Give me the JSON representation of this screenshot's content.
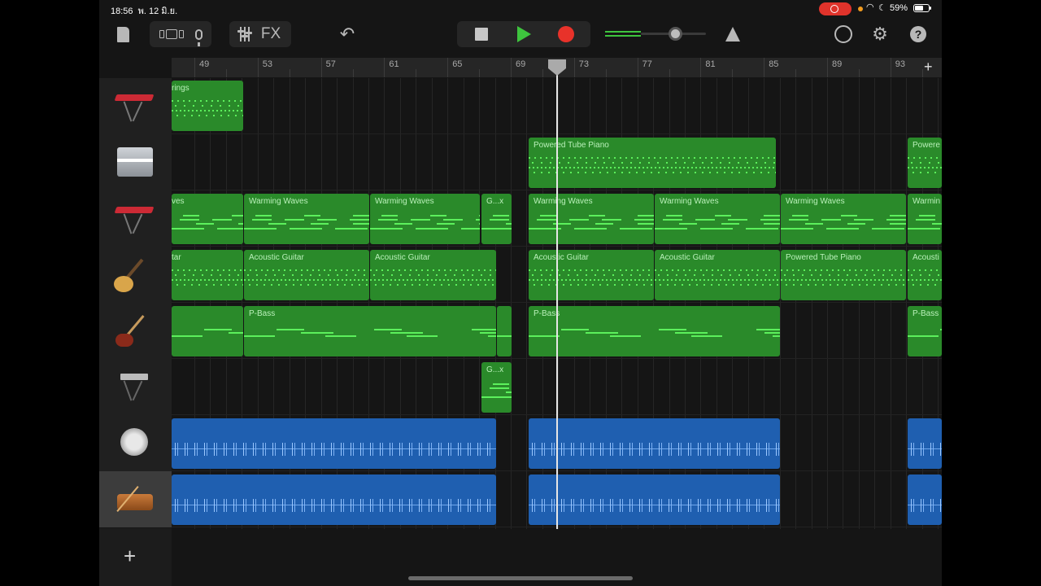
{
  "status_bar": {
    "time": "18:56",
    "date": "พ. 12 มิ.ย.",
    "battery": "59%"
  },
  "toolbar": {
    "fx_label": "FX",
    "accent_play": "#3ec43e",
    "accent_record": "#e8322a",
    "volume_level": 0.65
  },
  "ruler": {
    "bars": [
      "49",
      "53",
      "57",
      "61",
      "65",
      "69",
      "73",
      "77",
      "81",
      "85",
      "89",
      "93"
    ],
    "add_label": "+"
  },
  "tracks": [
    {
      "instrument": "keyboard-red-icon",
      "regions": [
        {
          "label": "rings",
          "color": "#2a8a2a"
        }
      ]
    },
    {
      "instrument": "piano-icon",
      "regions": [
        {
          "label": "Powered Tube Piano"
        },
        {
          "label": "Powere"
        }
      ]
    },
    {
      "instrument": "keyboard-red-icon",
      "regions": [
        {
          "label": "ves"
        },
        {
          "label": "Warming Waves"
        },
        {
          "label": "Warming Waves"
        },
        {
          "label": "G...x"
        },
        {
          "label": "Warming Waves"
        },
        {
          "label": "Warming Waves"
        },
        {
          "label": "Warming Waves"
        },
        {
          "label": "Warmin"
        }
      ]
    },
    {
      "instrument": "acoustic-guitar-icon",
      "regions": [
        {
          "label": "tar"
        },
        {
          "label": "Acoustic Guitar"
        },
        {
          "label": "Acoustic Guitar"
        },
        {
          "label": "Acoustic Guitar"
        },
        {
          "label": "Acoustic Guitar"
        },
        {
          "label": "Powered Tube Piano"
        },
        {
          "label": "Acousti"
        }
      ]
    },
    {
      "instrument": "bass-guitar-icon",
      "regions": [
        {
          "label": ""
        },
        {
          "label": "P-Bass"
        },
        {
          "label": "P-Bass"
        },
        {
          "label": "P-Bass"
        }
      ]
    },
    {
      "instrument": "synth-keyboard-icon",
      "regions": [
        {
          "label": "G...x"
        }
      ]
    },
    {
      "instrument": "bass-drum-icon",
      "regions": [],
      "color": "#1f5fb0"
    },
    {
      "instrument": "snare-drum-icon",
      "regions": [],
      "color": "#1f5fb0"
    }
  ],
  "add_track_label": "+"
}
